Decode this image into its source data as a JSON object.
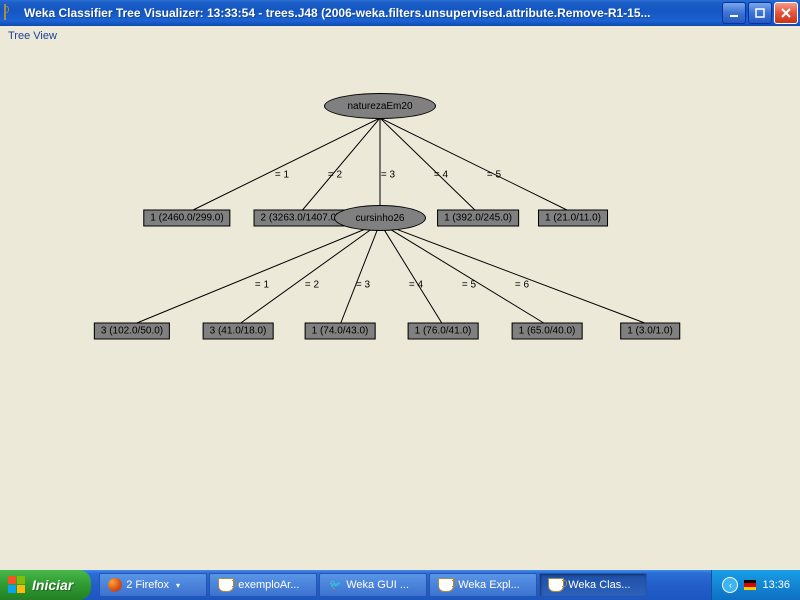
{
  "window": {
    "title": "Weka Classifier Tree Visualizer: 13:33:54 - trees.J48 (2006-weka.filters.unsupervised.attribute.Remove-R1-15..."
  },
  "menu": {
    "tree_view": "Tree View"
  },
  "tree": {
    "root": {
      "label": "naturezaEm20"
    },
    "root_edges": [
      "= 1",
      "= 2",
      "= 3",
      "= 4",
      "= 5"
    ],
    "level1": {
      "leaf1": "1 (2460.0/299.0)",
      "leaf2": "2 (3263.0/1407.0)",
      "node3": "cursinho26",
      "leaf4": "1 (392.0/245.0)",
      "leaf5": "1 (21.0/11.0)"
    },
    "node3_edges": [
      "= 1",
      "= 2",
      "= 3",
      "= 4",
      "= 5",
      "= 6"
    ],
    "level2": {
      "leaf1": "3 (102.0/50.0)",
      "leaf2": "3 (41.0/18.0)",
      "leaf3": "1 (74.0/43.0)",
      "leaf4": "1 (76.0/41.0)",
      "leaf5": "1 (65.0/40.0)",
      "leaf6": "1 (3.0/1.0)"
    }
  },
  "taskbar": {
    "start": "Iniciar",
    "items": [
      {
        "label": "2 Firefox",
        "icon": "firefox",
        "active": false,
        "drop": true
      },
      {
        "label": "exemploAr...",
        "icon": "cup",
        "active": false
      },
      {
        "label": "Weka GUI ...",
        "icon": "bird",
        "active": false
      },
      {
        "label": "Weka Expl...",
        "icon": "cup",
        "active": false
      },
      {
        "label": "Weka Clas...",
        "icon": "cup",
        "active": true
      }
    ],
    "clock": "13:36"
  }
}
